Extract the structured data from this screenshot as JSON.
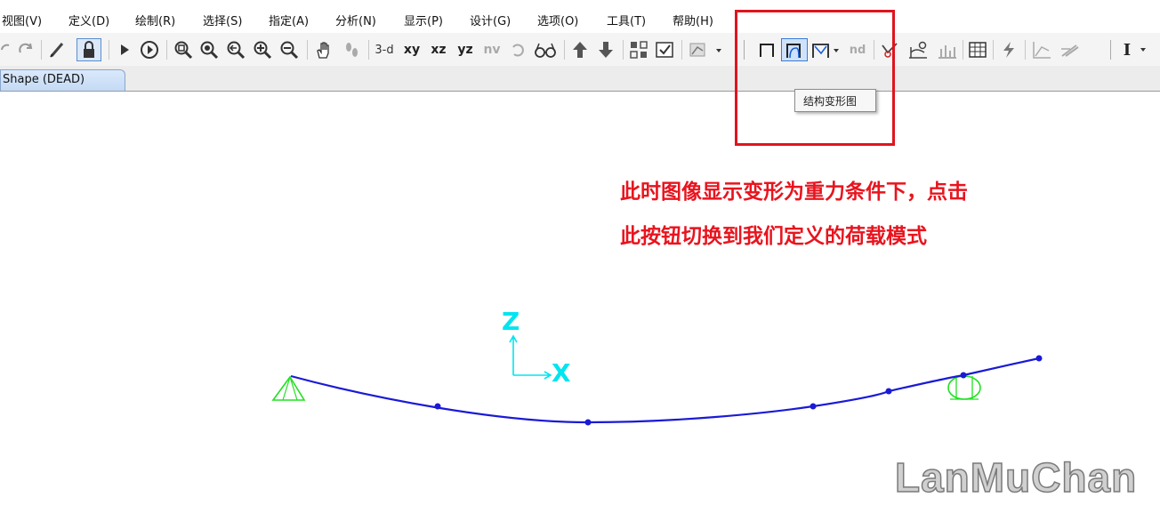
{
  "menu": {
    "items": [
      "视图(V)",
      "定义(D)",
      "绘制(R)",
      "选择(S)",
      "指定(A)",
      "分析(N)",
      "显示(P)",
      "设计(G)",
      "选项(O)",
      "工具(T)",
      "帮助(H)"
    ]
  },
  "toolbar": {
    "view_3d": "3-d",
    "view_xy": "xy",
    "view_xz": "xz",
    "view_yz": "yz",
    "view_nv": "nv",
    "node_label": "nd",
    "text_tool": "I"
  },
  "tab": {
    "label": "Shape (DEAD)"
  },
  "tooltip": {
    "text": "结构变形图"
  },
  "annotation": {
    "line1": "此时图像显示变形为重力条件下，点击",
    "line2": "此按钮切换到我们定义的荷载模式"
  },
  "axes": {
    "z_label": "Z",
    "x_label": "X"
  },
  "watermark": {
    "text": "LanMuChan"
  },
  "colors": {
    "deformed_shape": "#1a1ad6",
    "support": "#22e022",
    "axes": "#00e5f0",
    "annotation": "#e8141e",
    "highlight_box": "#e0141e"
  }
}
